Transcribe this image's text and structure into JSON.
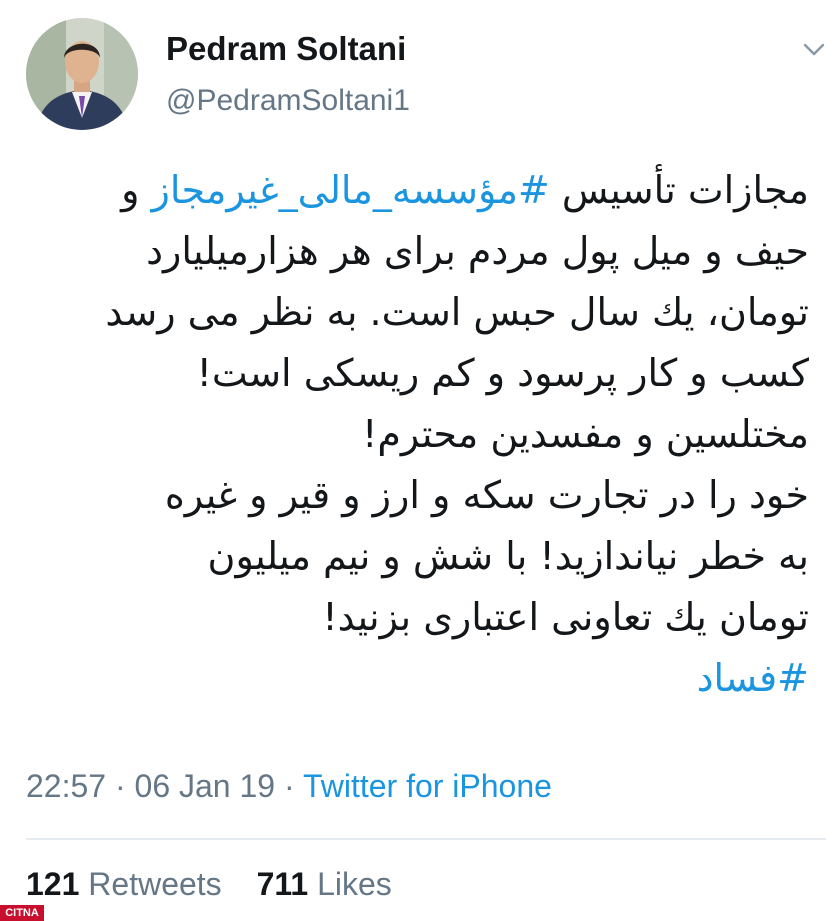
{
  "tweet": {
    "display_name": "Pedram Soltani",
    "handle": "@PedramSoltani1",
    "lines": [
      {
        "before": "مجازات تأسیس ",
        "hashtag": "#مؤسسه_مالی_غیرمجاز",
        "after": " و"
      },
      {
        "text": "حیف و میل پول مردم برای هر هزارمیلیارد"
      },
      {
        "text": "تومان، یك سال حبس است. به نظر می رسد"
      },
      {
        "text": "کسب و کار پرسود و کم ریسکی است!"
      },
      {
        "text": "مختلسین و مفسدین محترم!"
      },
      {
        "text": "خود را در تجارت سکه و ارز و قیر و غیره"
      },
      {
        "text": "به خطر نیاندازید! با شش و نیم میلیون"
      },
      {
        "text": "تومان یك تعاونی اعتباری بزنید!"
      }
    ],
    "closing_hashtag": "#فساد",
    "time": "22:57",
    "date": "06 Jan 19",
    "separator": "·",
    "source": "Twitter for iPhone",
    "retweets_count": "121",
    "retweets_label": "Retweets",
    "likes_count": "711",
    "likes_label": "Likes"
  },
  "icons": {
    "caret": "chevron-down-icon",
    "avatar": "profile-photo"
  },
  "colors": {
    "link": "#1b95e0",
    "secondary": "#657786",
    "primary_text": "#14171a",
    "divider": "#e6ecf0",
    "watermark_bg": "#c8102e"
  },
  "watermark": {
    "text": "CITNA"
  }
}
